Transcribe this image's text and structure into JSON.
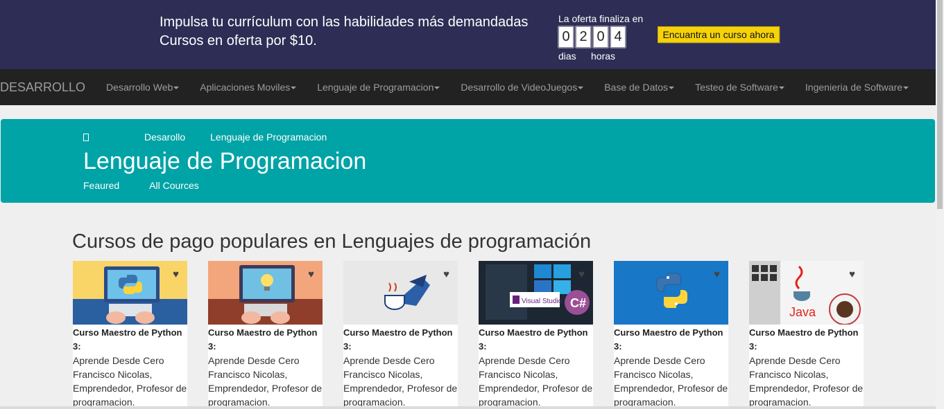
{
  "promo": {
    "line1": "Impulsa tu currículum con las habilidades más demandadas",
    "line2": "Cursos en oferta por $10.",
    "offer_label": "La oferta finaliza en",
    "digits": [
      "0",
      "2",
      "0",
      "4"
    ],
    "unit_days": "dias",
    "unit_hours": "horas",
    "cta": "Encuantra un curso ahora"
  },
  "nav": {
    "brand": "DESARROLLO",
    "items": [
      "Desarrollo Web",
      "Aplicaciones Moviles",
      "Lenguaje de Programacion",
      "Desarrollo de VideoJuegos",
      "Base de Datos",
      "Testeo de Software",
      "Ingenieria de Software"
    ]
  },
  "hero": {
    "crumb1": "Desarollo",
    "crumb2": "Lenguaje de Programacion",
    "title": "Lenguaje de Programacion",
    "tab1": "Feaured",
    "tab2": "All Cources"
  },
  "section": {
    "title": "Cursos de pago populares en Lenguajes de programación"
  },
  "cards": [
    {
      "title": "Curso Maestro de Python 3:",
      "desc": "Aprende Desde Cero Francisco Nicolas, Emprendedor, Profesor de programacion.",
      "thumb": "python-laptop-yellow-icon"
    },
    {
      "title": "Curso Maestro de Python 3:",
      "desc": "Aprende Desde Cero Francisco Nicolas, Emprendedor, Profesor de programacion.",
      "thumb": "lightbulb-laptop-icon"
    },
    {
      "title": "Curso Maestro de Python 3:",
      "desc": "Aprende Desde Cero Francisco Nicolas, Emprendedor, Profesor de programacion.",
      "thumb": "java-bird-icon"
    },
    {
      "title": "Curso Maestro de Python 3:",
      "desc": "Aprende Desde Cero Francisco Nicolas, Emprendedor, Profesor de programacion.",
      "thumb": "visual-studio-csharp-icon"
    },
    {
      "title": "Curso Maestro de Python 3:",
      "desc": "Aprende Desde Cero Francisco Nicolas, Emprendedor, Profesor de programacion.",
      "thumb": "python-logo-blue-icon"
    },
    {
      "title": "Curso Maestro de Python 3:",
      "desc": "Aprende Desde Cero Francisco Nicolas, Emprendedor, Profesor de programacion.",
      "thumb": "java-cup-icon"
    }
  ],
  "thumb_texts": {
    "vs": "Visual Studio",
    "cs": "C#",
    "java": "Java"
  },
  "heart_icon": "heart-icon",
  "colors": {
    "promo_bg": "#2e2d55",
    "nav_bg": "#222222",
    "hero_bg": "#00a3a6",
    "cta_bg": "#f5d20a"
  }
}
